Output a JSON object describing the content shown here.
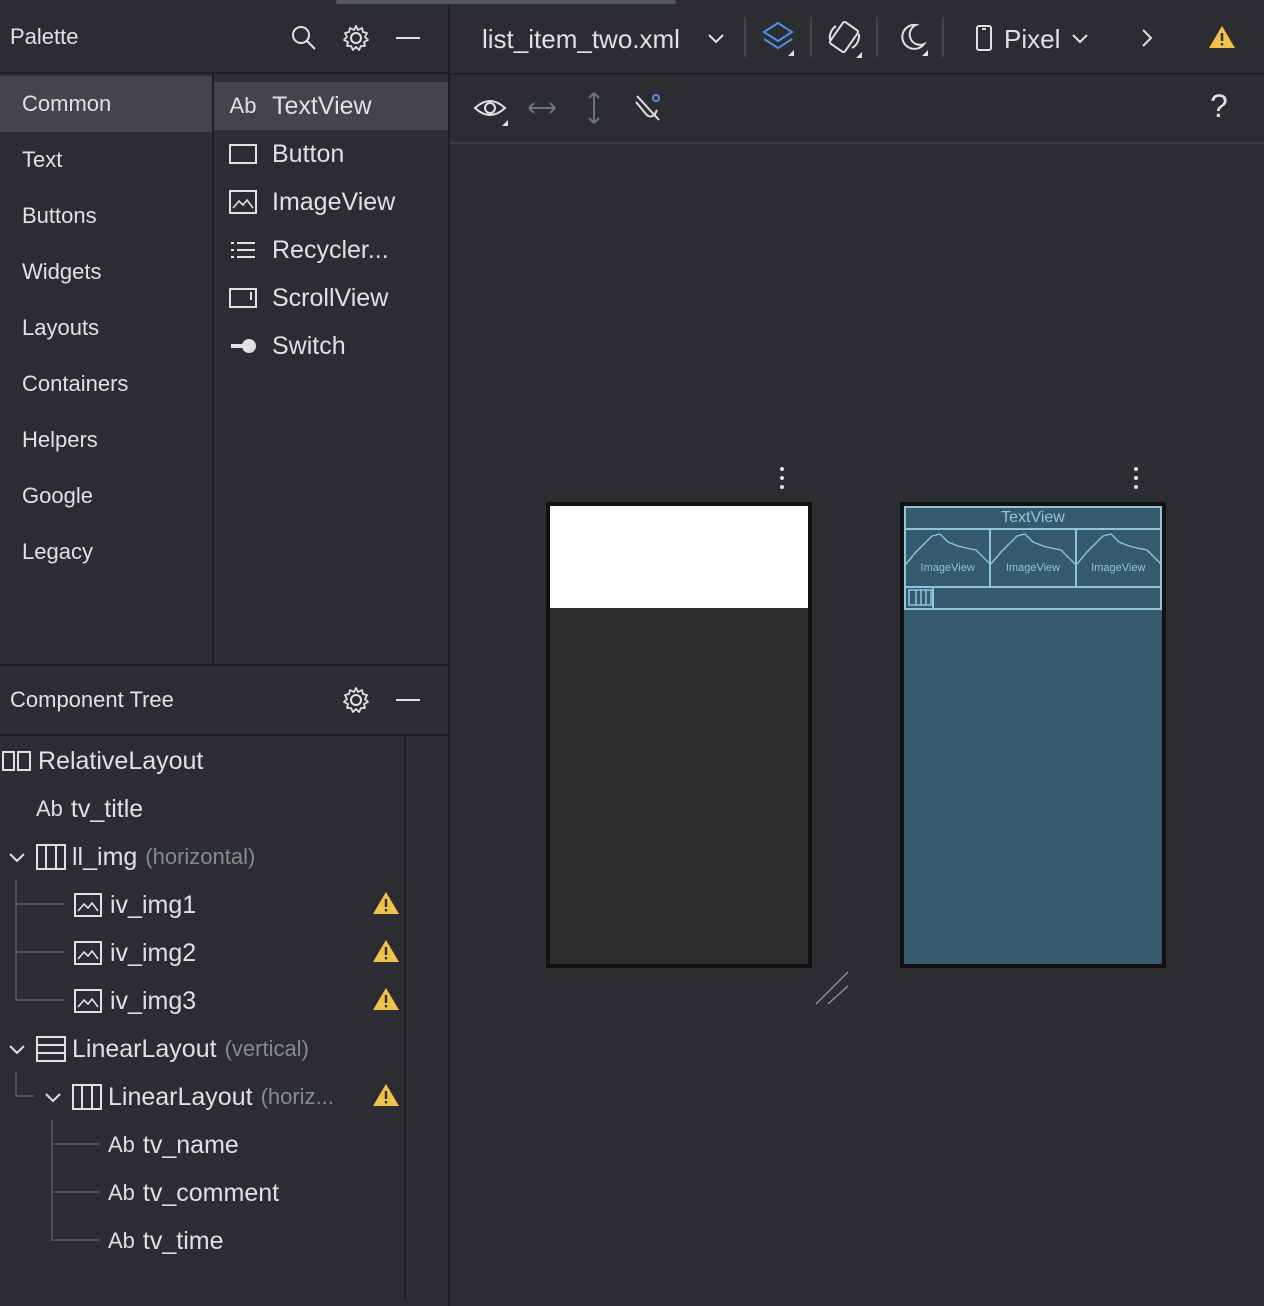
{
  "palette": {
    "title": "Palette",
    "categories": [
      "Common",
      "Text",
      "Buttons",
      "Widgets",
      "Layouts",
      "Containers",
      "Helpers",
      "Google",
      "Legacy"
    ],
    "items": [
      {
        "icon": "text-icon",
        "prefix": "Ab",
        "label": "TextView"
      },
      {
        "icon": "button-icon",
        "label": "Button"
      },
      {
        "icon": "image-icon",
        "label": "ImageView"
      },
      {
        "icon": "list-icon",
        "label": "Recycler..."
      },
      {
        "icon": "scroll-icon",
        "label": "ScrollView"
      },
      {
        "icon": "switch-icon",
        "label": "Switch"
      }
    ]
  },
  "component_tree": {
    "title": "Component Tree",
    "nodes": [
      {
        "label": "RelativeLayout",
        "hint": "",
        "prefix": ""
      },
      {
        "label": "tv_title",
        "hint": "",
        "prefix": "Ab"
      },
      {
        "label": "ll_img",
        "hint": "(horizontal)",
        "prefix": ""
      },
      {
        "label": "iv_img1",
        "hint": "",
        "prefix": ""
      },
      {
        "label": "iv_img2",
        "hint": "",
        "prefix": ""
      },
      {
        "label": "iv_img3",
        "hint": "",
        "prefix": ""
      },
      {
        "label": "LinearLayout",
        "hint": "(vertical)",
        "prefix": ""
      },
      {
        "label": "LinearLayout",
        "hint": "(horiz...",
        "prefix": ""
      },
      {
        "label": "tv_name",
        "hint": "",
        "prefix": "Ab"
      },
      {
        "label": "tv_comment",
        "hint": "",
        "prefix": "Ab"
      },
      {
        "label": "tv_time",
        "hint": "",
        "prefix": "Ab"
      }
    ]
  },
  "toolbar": {
    "file_name": "list_item_two.xml",
    "device": "Pixel",
    "help": "?"
  },
  "blueprint": {
    "textview_label": "TextView",
    "imageview_label": "ImageView"
  },
  "colors": {
    "background": "#2b2d30",
    "selected": "#43454a",
    "blueprint_fill": "#345a6c",
    "blueprint_line": "#8ec5dc",
    "warning": "#f0c14b",
    "accent_blue": "#4e8de8"
  }
}
